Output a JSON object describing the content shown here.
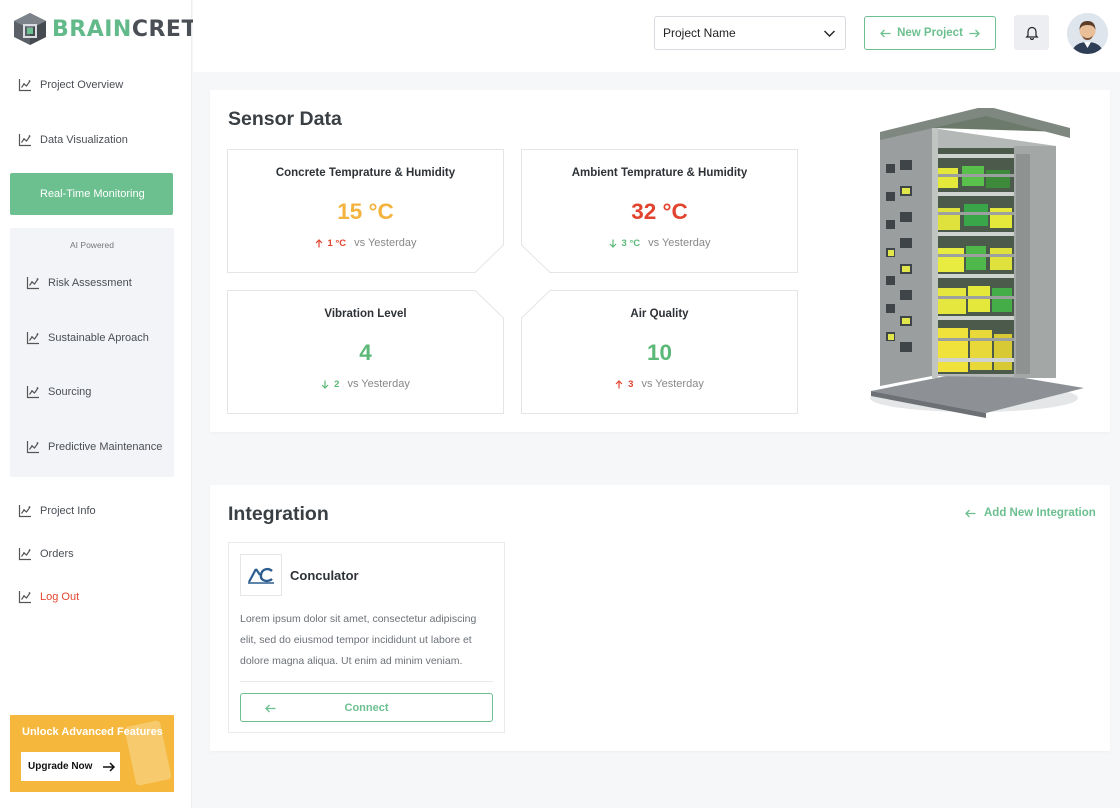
{
  "brand": {
    "part1": "BRAIN",
    "part2": "CRETE"
  },
  "sidebar": {
    "items": [
      {
        "label": "Project Overview",
        "icon": "chart-line-icon"
      },
      {
        "label": "Data Visualization",
        "icon": "chart-line-icon"
      },
      {
        "label": "Real-Time Monitoring",
        "icon": "chart-line-icon",
        "active": true
      }
    ],
    "ai_group": {
      "label": "AI Powered",
      "items": [
        {
          "label": "Risk Assessment",
          "icon": "chart-line-icon"
        },
        {
          "label": "Sustainable Aproach",
          "icon": "chart-line-icon"
        },
        {
          "label": "Sourcing",
          "icon": "chart-line-icon"
        },
        {
          "label": "Predictive Maintenance",
          "icon": "chart-line-icon"
        }
      ]
    },
    "bottom_items": [
      {
        "label": "Project Info",
        "icon": "chart-line-icon"
      },
      {
        "label": "Orders",
        "icon": "chart-line-icon"
      },
      {
        "label": "Log Out",
        "icon": "chart-line-icon"
      }
    ],
    "upgrade": {
      "title": "Unlock Advanced Features",
      "button": "Upgrade Now"
    }
  },
  "topbar": {
    "project_select": "Project Name",
    "new_project": "New Project",
    "icons": [
      "bell-icon",
      "avatar"
    ]
  },
  "sensor": {
    "title": "Sensor Data",
    "cards": [
      {
        "title": "Concrete Temprature & Humidity",
        "value": "15 °C",
        "delta": "1 °C",
        "direction": "up",
        "compare": "vs Yesterday"
      },
      {
        "title": "Ambient Temprature & Humidity",
        "value": "32 °C",
        "delta": "3 °C",
        "direction": "down",
        "compare": "vs Yesterday"
      },
      {
        "title": "Vibration Level",
        "value": "4",
        "delta": "2",
        "direction": "down",
        "compare": "vs Yesterday"
      },
      {
        "title": "Air Quality",
        "value": "10",
        "delta": "3",
        "direction": "up",
        "compare": "vs Yesterday"
      }
    ]
  },
  "integration": {
    "title": "Integration",
    "add_label": "Add New Integration",
    "card": {
      "name": "Conculator",
      "description": "Lorem ipsum dolor sit amet, consectetur adipiscing elit, sed do eiusmod tempor incididunt ut labore et dolore magna aliqua. Ut enim ad minim veniam.",
      "button": "Connect"
    }
  },
  "colors": {
    "accent": "#6cc08f",
    "warning": "#f5b83d",
    "danger": "#e4462f",
    "value_orange": "#f3b33e",
    "value_red": "#e2432e",
    "value_green": "#5bb877"
  }
}
